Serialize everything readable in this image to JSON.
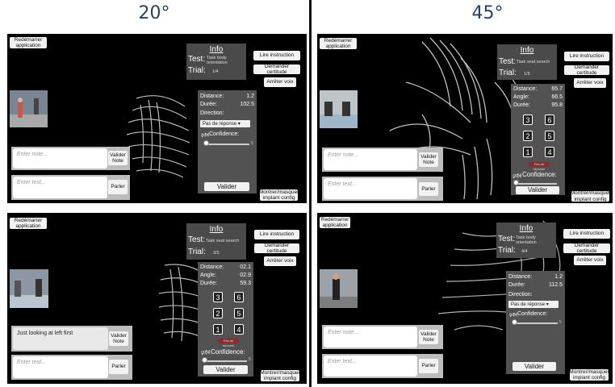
{
  "columns": {
    "left_title": "20°",
    "right_title": "45°"
  },
  "common": {
    "restart": "Redémarrer application",
    "read_instruction": "Lire instruction",
    "ask_certainty": "Demander certitude",
    "stop_voice": "Arrêter voix",
    "toggle_implant": "Montrer/masquer implant config",
    "validate_note": "Valider Note",
    "speak": "Parler",
    "note_placeholder": "Enter note...",
    "text_placeholder": "Enter text...",
    "info_title": "Info",
    "test_label": "Test:",
    "trial_label": "Trial:",
    "distance_label": "Distance:",
    "angle_label": "Angle:",
    "duration_label": "Durée:",
    "direction_label": "Direction:",
    "confidence_label": "Confidence:",
    "validate": "Valider",
    "no_response": "Pas de réponse",
    "no_response_small": "Pas de réponse",
    "slider_max": "5"
  },
  "panels": [
    {
      "test_value": "Task body orientation",
      "trial_value": "1/4",
      "distance": "1.2",
      "duration": "102.5",
      "note_value": ""
    },
    {
      "test_value": "Task seat search",
      "trial_value": "1/5",
      "distance": "65.7",
      "angle": "66.5",
      "duration": "95.8",
      "note_value": ""
    },
    {
      "test_value": "Task seat search",
      "trial_value": "3/5",
      "distance": "02.1",
      "angle": "02.9",
      "duration": "59.3",
      "note_value": "Just looking at left first"
    },
    {
      "test_value": "Task body orientation",
      "trial_value": "4/4",
      "distance": "1.2",
      "duration": "112.5",
      "note_value": ""
    }
  ],
  "keypad": [
    "3",
    "6",
    "2",
    "5",
    "1",
    "4"
  ]
}
